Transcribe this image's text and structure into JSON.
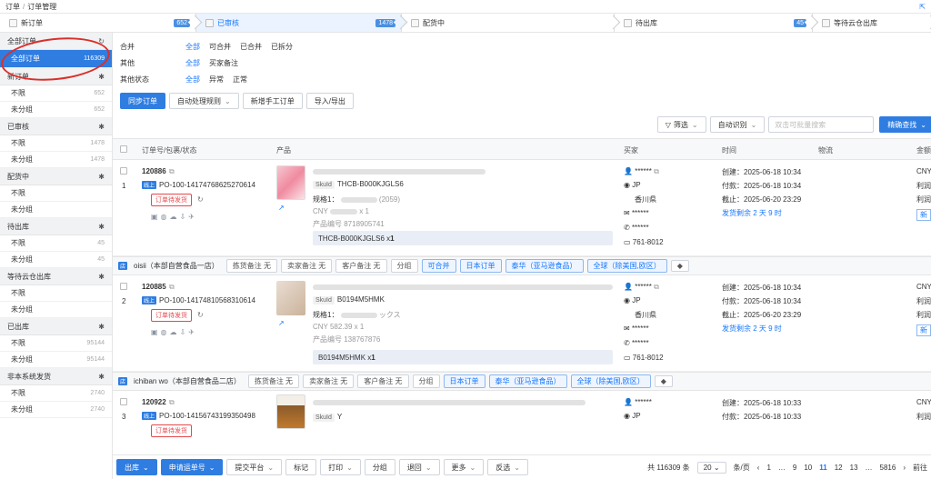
{
  "breadcrumb": {
    "root": "订单",
    "sep": "/",
    "current": "订单管理"
  },
  "steps": [
    {
      "label": "新订单",
      "count": "652"
    },
    {
      "label": "已审核",
      "count": "1478"
    },
    {
      "label": "配货中",
      "count": ""
    },
    {
      "label": "待出库",
      "count": "45"
    },
    {
      "label": "等待云仓出库",
      "count": ""
    }
  ],
  "sidebar": {
    "all": {
      "label": "全部订单",
      "item": "全部订单",
      "count": "116309"
    },
    "groups": [
      {
        "label": "新订单",
        "items": [
          {
            "label": "不限",
            "count": "652"
          },
          {
            "label": "未分组",
            "count": "652"
          }
        ]
      },
      {
        "label": "已审核",
        "items": [
          {
            "label": "不限",
            "count": "1478"
          },
          {
            "label": "未分组",
            "count": "1478"
          }
        ]
      },
      {
        "label": "配货中",
        "items": [
          {
            "label": "不限",
            "count": ""
          },
          {
            "label": "未分组",
            "count": ""
          }
        ]
      },
      {
        "label": "待出库",
        "items": [
          {
            "label": "不限",
            "count": "45"
          },
          {
            "label": "未分组",
            "count": "45"
          }
        ]
      },
      {
        "label": "等待云仓出库",
        "items": [
          {
            "label": "不限",
            "count": ""
          },
          {
            "label": "未分组",
            "count": ""
          }
        ]
      },
      {
        "label": "已出库",
        "items": [
          {
            "label": "不限",
            "count": "95144"
          },
          {
            "label": "未分组",
            "count": "95144"
          }
        ]
      },
      {
        "label": "非本系统发货",
        "items": [
          {
            "label": "不限",
            "count": "2740"
          },
          {
            "label": "未分组",
            "count": "2740"
          }
        ]
      }
    ]
  },
  "filters": [
    {
      "key": "合并",
      "options": [
        "全部",
        "可合并",
        "已合并",
        "已拆分"
      ]
    },
    {
      "key": "其他",
      "options": [
        "全部",
        "买家备注"
      ]
    },
    {
      "key": "其他状态",
      "options": [
        "全部",
        "异常",
        "正常"
      ]
    }
  ],
  "toolbar": {
    "sync": "同步订单",
    "auto_rules": "自动处理规则",
    "add_manual": "新增手工订单",
    "import_export": "导入/导出"
  },
  "search": {
    "filter": "筛选",
    "auto_identify": "自动识别",
    "placeholder": "双击可批量搜索",
    "precise": "精确查找"
  },
  "table_headers": {
    "order": "订单号/包裹/状态",
    "product": "产品",
    "buyer": "买家",
    "time": "时间",
    "logistics": "物流",
    "amount": "金额"
  },
  "orders": [
    {
      "index": "1",
      "order_no": "120886",
      "platform": "线上",
      "po": "PO-100-14174768625270614",
      "status": "订单待发货",
      "sku_label": "SkuId",
      "sku": "THCB-B000KJGLS6",
      "spec": "规格1：",
      "spec_value": "(2059)",
      "price": "CNY",
      "price_value": "x 1",
      "product_code_label": "产品编号",
      "product_code": "8718905741",
      "sku_qty": "THCB-B000KJGLS6 x ",
      "qty": "1",
      "buyer_name": "******",
      "country": "JP",
      "region": "香川県",
      "email": "******",
      "phone": "******",
      "zip": "761-8012",
      "created": "创建：2025-06-18 10:34",
      "paid": "付款：2025-06-18 10:34",
      "deadline": "截止：2025-06-20 23:29",
      "remaining": "发货剩余 2 天 9 时",
      "amount_cur": "CNY",
      "amount_l1": "利润",
      "amount_l2": "利润",
      "amount_btn": "新"
    },
    {
      "index": "2",
      "order_no": "120885",
      "platform": "线上",
      "po": "PO-100-14174810568310614",
      "status": "订单待发货",
      "sku_label": "SkuId",
      "sku": "B0194M5HMK",
      "spec": "规格1：",
      "spec_value": "ックス",
      "price": "CNY 582.39 x ",
      "price_value": "1",
      "product_code_label": "产品编号",
      "product_code": "138767876",
      "sku_qty": "B0194M5HMK x ",
      "qty": "1",
      "buyer_name": "******",
      "country": "JP",
      "region": "香川県",
      "email": "******",
      "phone": "******",
      "zip": "761-8012",
      "created": "创建：2025-06-18 10:34",
      "paid": "付款：2025-06-18 10:34",
      "deadline": "截止：2025-06-20 23:29",
      "remaining": "发货剩余 2 天 9 时",
      "amount_cur": "CNY",
      "amount_l1": "利润",
      "amount_l2": "利润",
      "amount_btn": "新"
    },
    {
      "index": "3",
      "order_no": "120922",
      "platform": "线上",
      "po": "PO-100-14156743199350498",
      "status": "订单待发货",
      "sku_label": "SkuId",
      "sku": "Y",
      "buyer_name": "******",
      "country": "JP",
      "created": "创建：2025-06-18 10:33",
      "paid": "付款：2025-06-18 10:33",
      "amount_cur": "CNY",
      "amount_l1": "利润"
    }
  ],
  "shop_rows": [
    {
      "shop": "oisii（本部自营食品一店）",
      "pick_note": "拣货备注 无",
      "seller_note": "卖家备注 无",
      "customer_note": "客户备注 无",
      "group": "分组",
      "tags": [
        "可合并",
        "日本订单",
        "泰华（亚马逊食品）",
        "全球（除美国,欧区）"
      ]
    },
    {
      "shop": "ichiban wo（本部自营食品二店）",
      "pick_note": "拣货备注 无",
      "seller_note": "卖家备注 无",
      "customer_note": "客户备注 无",
      "group": "分组",
      "tags": [
        "日本订单",
        "泰华（亚马逊食品）",
        "全球（除美国,欧区）"
      ]
    }
  ],
  "bottom": {
    "ship": "出库",
    "apply_tracking": "申请运单号",
    "submit_platform": "提交平台",
    "mark": "标记",
    "print": "打印",
    "group": "分组",
    "return": "退回",
    "more": "更多",
    "invert": "反选",
    "total": "共 116309 条",
    "page_size": "20",
    "per_page": "条/页",
    "pages": [
      "1",
      "…",
      "9",
      "10",
      "11",
      "12",
      "13",
      "…",
      "5816"
    ],
    "current_page": "11",
    "goto": "前往"
  }
}
